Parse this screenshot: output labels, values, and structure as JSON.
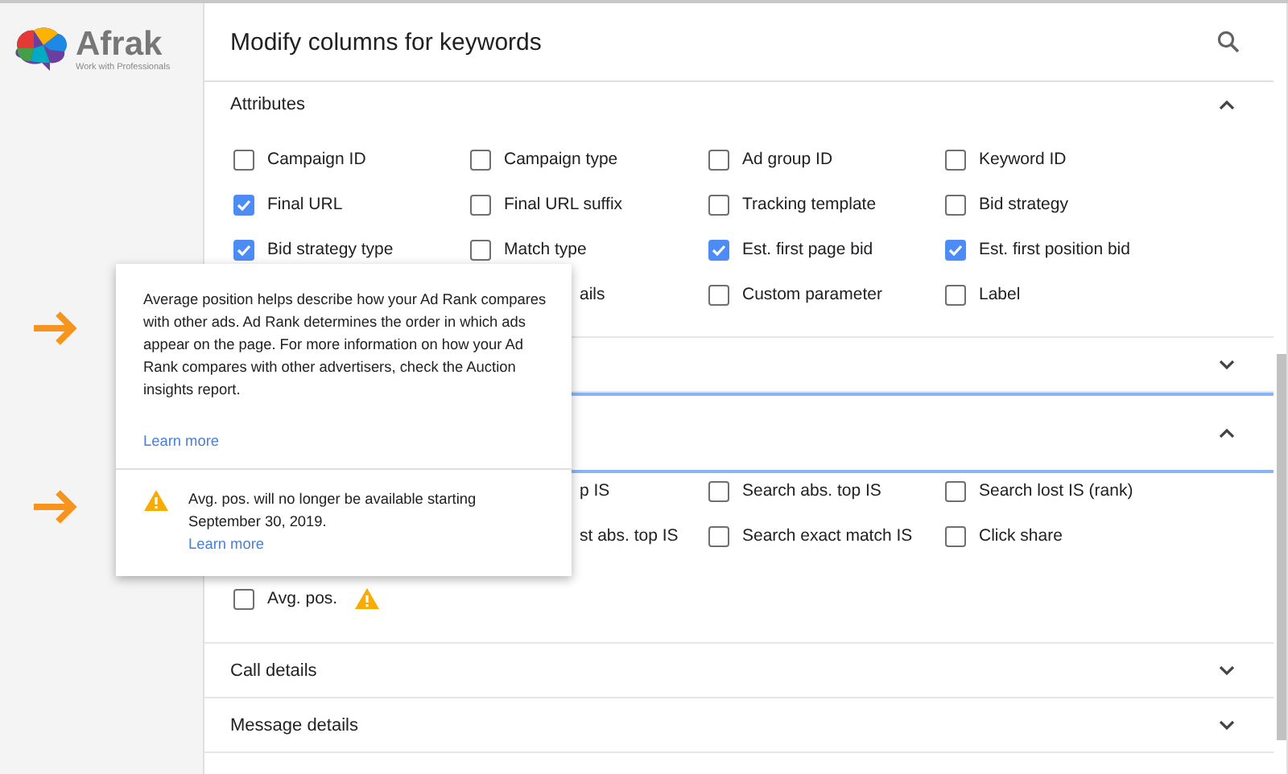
{
  "logo": {
    "name": "Afrak",
    "tagline": "Work with Professionals"
  },
  "dialog": {
    "title": "Modify columns for keywords"
  },
  "sections": [
    {
      "title": "Attributes",
      "expanded": true,
      "focused": false,
      "items": [
        {
          "kind": "checkbox",
          "label": "Campaign ID",
          "checked": false
        },
        {
          "kind": "checkbox",
          "label": "Campaign type",
          "checked": false
        },
        {
          "kind": "checkbox",
          "label": "Ad group ID",
          "checked": false
        },
        {
          "kind": "checkbox",
          "label": "Keyword ID",
          "checked": false
        },
        {
          "kind": "checkbox",
          "label": "Final URL",
          "checked": true
        },
        {
          "kind": "checkbox",
          "label": "Final URL suffix",
          "checked": false
        },
        {
          "kind": "checkbox",
          "label": "Tracking template",
          "checked": false
        },
        {
          "kind": "checkbox",
          "label": "Bid strategy",
          "checked": false
        },
        {
          "kind": "checkbox",
          "label": "Bid strategy type",
          "checked": true
        },
        {
          "kind": "checkbox",
          "label": "Match type",
          "checked": false
        },
        {
          "kind": "checkbox",
          "label": "Est. first page bid",
          "checked": true
        },
        {
          "kind": "checkbox",
          "label": "Est. first position bid",
          "checked": true
        },
        {
          "kind": "covered"
        },
        {
          "kind": "partial",
          "label": "ails"
        },
        {
          "kind": "checkbox",
          "label": "Custom parameter",
          "checked": false
        },
        {
          "kind": "checkbox",
          "label": "Label",
          "checked": false
        }
      ]
    },
    {
      "expanded": false,
      "focused": false
    },
    {
      "expanded": true,
      "focused": true,
      "items": [
        {
          "kind": "covered"
        },
        {
          "kind": "partial",
          "label": "p IS"
        },
        {
          "kind": "checkbox",
          "label": "Search abs. top IS",
          "checked": false
        },
        {
          "kind": "checkbox",
          "label": "Search lost IS (rank)",
          "checked": false
        },
        {
          "kind": "covered"
        },
        {
          "kind": "partial",
          "label": "st abs. top IS"
        },
        {
          "kind": "checkbox",
          "label": "Search exact match IS",
          "checked": false
        },
        {
          "kind": "checkbox",
          "label": "Click share",
          "checked": false
        },
        {
          "kind": "checkbox",
          "label": "Avg. pos.",
          "checked": false,
          "warning": true
        }
      ]
    },
    {
      "title": "Call details",
      "expanded": false,
      "focused": false
    },
    {
      "title": "Message details",
      "expanded": false,
      "focused": false
    }
  ],
  "popover": {
    "text": "Average position helps describe how your Ad Rank compares with other ads. Ad Rank determines the order in which ads appear on the page. For more information on how your Ad Rank compares with other advertisers, check the Auction insights report.",
    "link": "Learn more",
    "warning": {
      "text": "Avg. pos. will no longer be available starting September 30, 2019.",
      "link": "Learn more"
    }
  }
}
